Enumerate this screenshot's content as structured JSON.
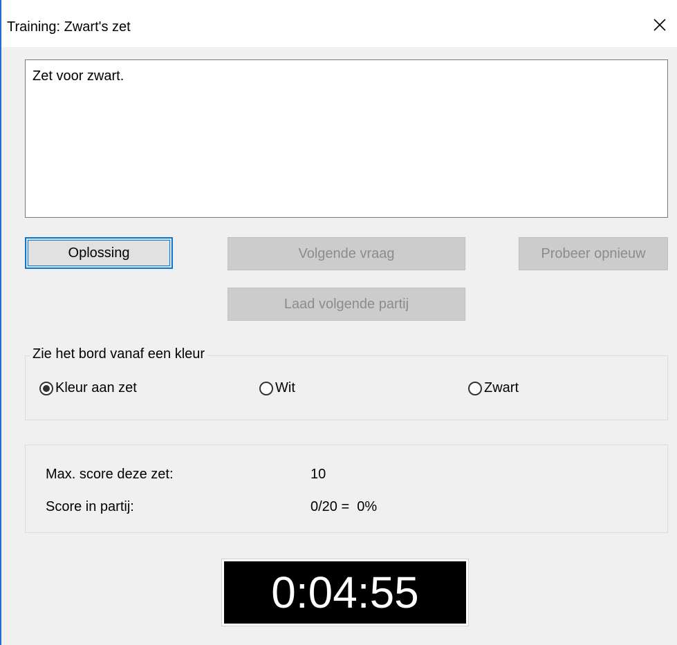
{
  "window": {
    "title": "Training: Zwart's zet"
  },
  "message": {
    "text": "Zet voor zwart."
  },
  "buttons": {
    "solution": "Oplossing",
    "next_question": "Volgende vraag",
    "try_again": "Probeer opnieuw",
    "load_next_game": "Laad volgende partij"
  },
  "view_group": {
    "legend": "Zie het bord vanaf een kleur",
    "options": [
      {
        "label": "Kleur aan zet",
        "checked": true
      },
      {
        "label": "Wit",
        "checked": false
      },
      {
        "label": "Zwart",
        "checked": false
      }
    ]
  },
  "score": {
    "max_label": "Max. score deze zet:",
    "max_value": "10",
    "party_label": "Score in partij:",
    "party_value": "0/20 =  0%"
  },
  "timer": {
    "value": "0:04:55"
  },
  "colors": {
    "accent": "#0a78d7",
    "window_border": "#1e6fd0",
    "dialog_bg": "#f0f0f0",
    "timer_bg": "#000000",
    "timer_fg": "#ffffff"
  },
  "icons": {
    "close": "close-icon",
    "radio": "radio-icon"
  }
}
